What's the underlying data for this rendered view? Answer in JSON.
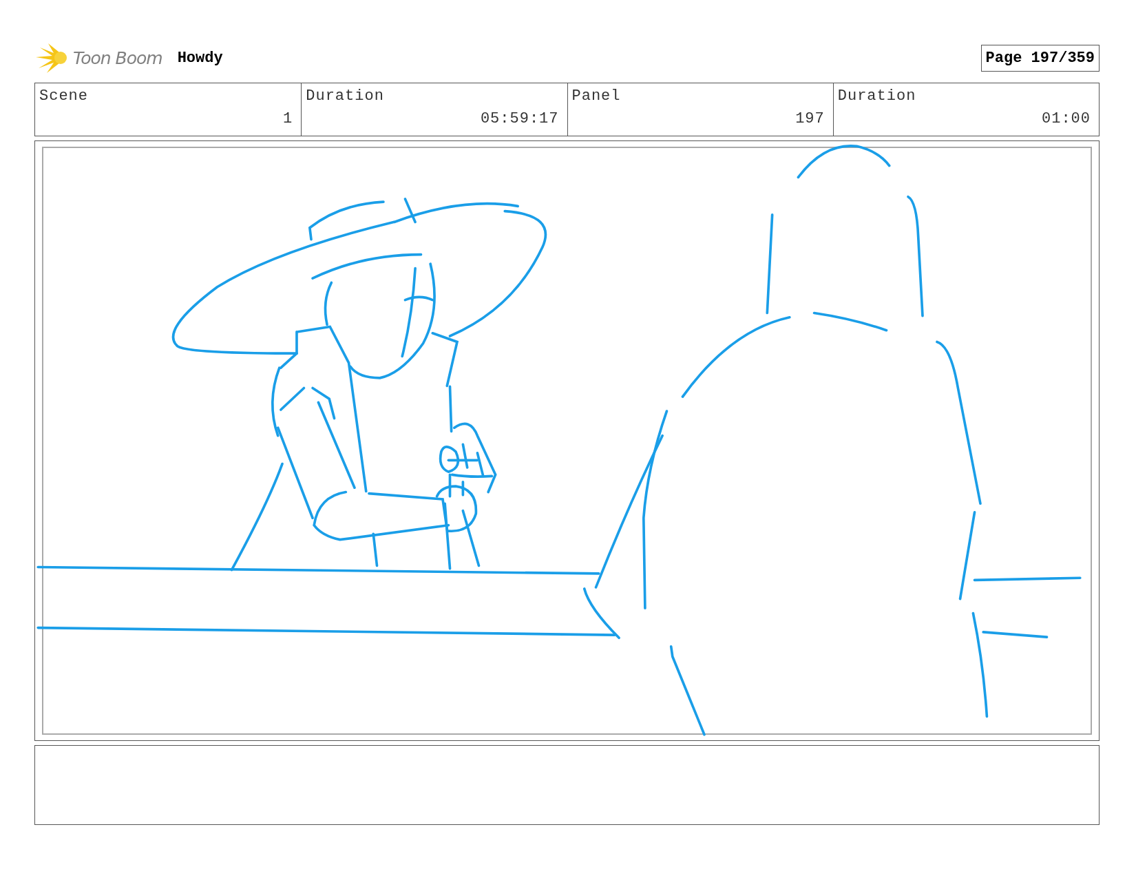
{
  "header": {
    "logo": "Toon Boom",
    "project": "Howdy",
    "page": "Page 197/359"
  },
  "info": [
    {
      "label": "Scene",
      "value": "1"
    },
    {
      "label": "Duration",
      "value": "05:59:17"
    },
    {
      "label": "Panel",
      "value": "197"
    },
    {
      "label": "Duration",
      "value": "01:00"
    }
  ]
}
